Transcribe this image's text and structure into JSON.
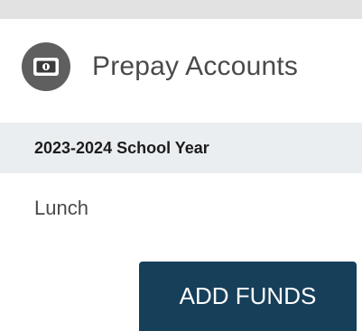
{
  "colors": {
    "top_bar": "#e2e2e2",
    "icon_circle": "#5f5f5f",
    "section_row_bg": "#ebeef0",
    "button_bg": "#163f5a",
    "button_text": "#ffffff",
    "title_text": "#4a4a4a"
  },
  "card": {
    "icon": "money-icon",
    "title": "Prepay Accounts"
  },
  "section": {
    "label": "2023-2024 School Year"
  },
  "accounts": [
    {
      "label": "Lunch"
    }
  ],
  "actions": {
    "add_funds_label": "ADD FUNDS"
  }
}
